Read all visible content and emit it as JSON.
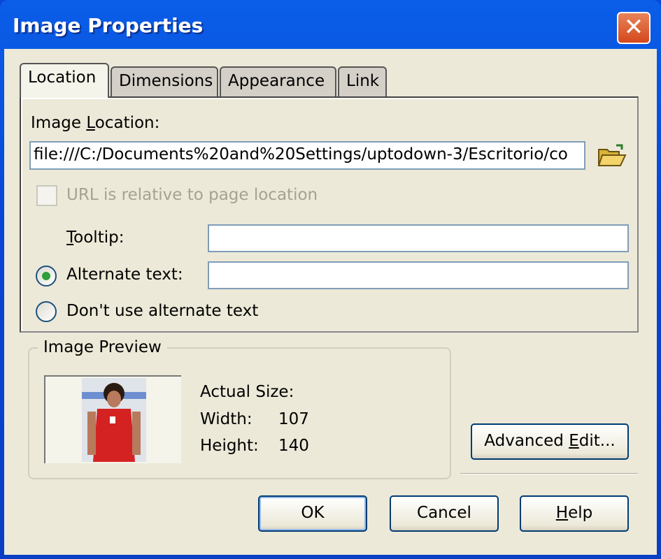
{
  "window": {
    "title": "Image Properties",
    "close_icon": "close-x-icon"
  },
  "tabs": [
    {
      "label": "Location",
      "active": true
    },
    {
      "label": "Dimensions"
    },
    {
      "label": "Appearance"
    },
    {
      "label": "Link"
    }
  ],
  "location": {
    "label": {
      "pre": "Image ",
      "key": "L",
      "post": "ocation:"
    },
    "value": "file:///C:/Documents%20and%20Settings/uptodown-3/Escritorio/co",
    "browse_icon": "open-folder-icon",
    "relative_checkbox": {
      "label": "URL is relative to page location",
      "checked": false,
      "disabled": true
    },
    "tooltip": {
      "label": {
        "pre": "",
        "key": "T",
        "post": "ooltip:"
      },
      "value": ""
    },
    "alt_radio": {
      "label": "Alternate text:",
      "selected": true
    },
    "alt_value": "",
    "no_alt_radio": {
      "label": "Don't use alternate text",
      "selected": false
    }
  },
  "preview": {
    "title": "Image Preview",
    "actual_size_label": "Actual Size:",
    "width_label": "Width:",
    "width_value": "107",
    "height_label": "Height:",
    "height_value": "140"
  },
  "buttons": {
    "advanced": {
      "pre": "Advanced ",
      "key": "E",
      "post": "dit..."
    },
    "ok": "OK",
    "cancel": "Cancel",
    "help": {
      "pre": "",
      "key": "H",
      "post": "elp"
    }
  }
}
